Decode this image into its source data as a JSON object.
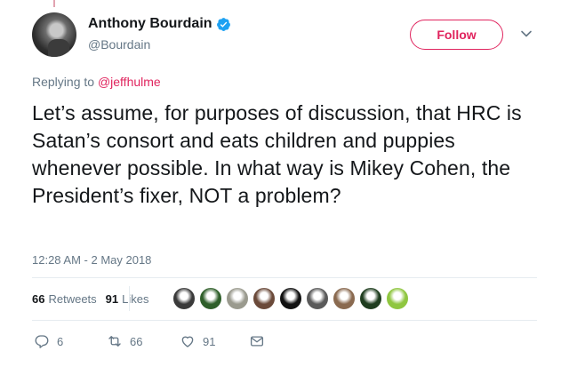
{
  "tweet": {
    "author": {
      "display_name": "Anthony Bourdain",
      "handle": "@Bourdain",
      "verified": true
    },
    "follow_label": "Follow",
    "reply_prefix": "Replying to ",
    "reply_to": "@jeffhulme",
    "text": "Let’s assume, for purposes of discussion, that HRC is Satan’s consort and eats children and puppies whenever possible. In what way is Mikey Cohen, the President’s fixer, NOT a problem?",
    "timestamp": "12:28 AM - 2 May 2018"
  },
  "stats": {
    "retweets_count": "66",
    "retweets_label": "Retweets",
    "likes_count": "91",
    "likes_label": "Likes"
  },
  "likers": [
    {
      "name": "liker-avatar-1",
      "color": "#3a3a3a"
    },
    {
      "name": "liker-avatar-2",
      "color": "#2f5f2a"
    },
    {
      "name": "liker-avatar-3",
      "color": "#9a9a8e"
    },
    {
      "name": "liker-avatar-4",
      "color": "#6b4a3a"
    },
    {
      "name": "liker-avatar-5",
      "color": "#111111"
    },
    {
      "name": "liker-avatar-6",
      "color": "#5a5a5a"
    },
    {
      "name": "liker-avatar-7",
      "color": "#8a6a50"
    },
    {
      "name": "liker-avatar-8",
      "color": "#1f3d1f"
    },
    {
      "name": "liker-avatar-9",
      "color": "#8fc640"
    }
  ],
  "actions": {
    "reply_count": "6",
    "retweet_count": "66",
    "like_count": "91"
  },
  "colors": {
    "accent": "#e0245e",
    "verified": "#1da1f2",
    "secondary_text": "#657786"
  }
}
